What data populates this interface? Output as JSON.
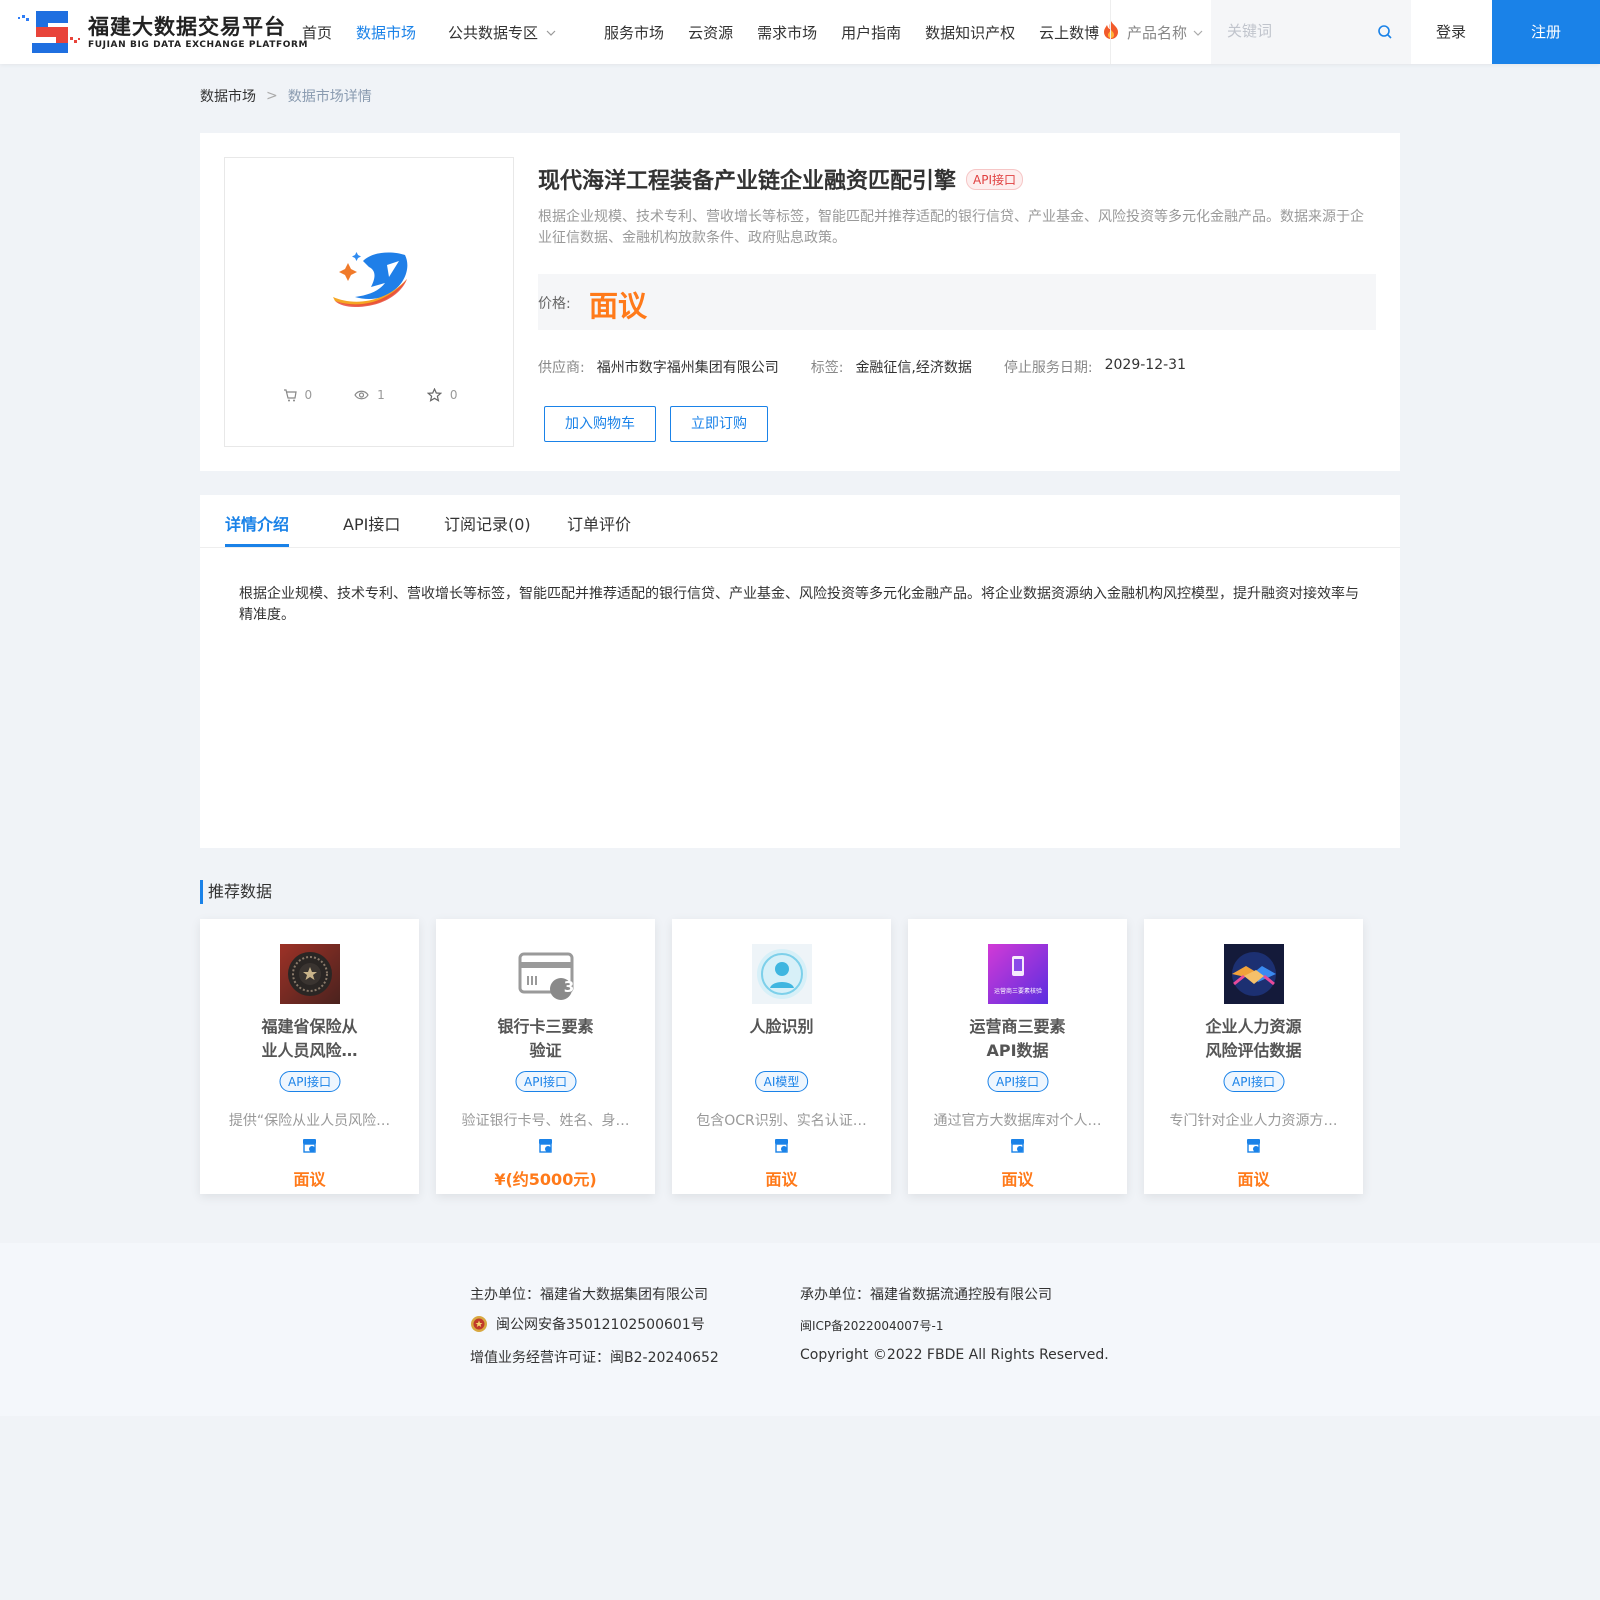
{
  "header": {
    "logo_cn": "福建大数据交易平台",
    "logo_en": "FUJIAN BIG DATA EXCHANGE  PLATFORM",
    "nav": [
      {
        "label": "首页"
      },
      {
        "label": "数据市场"
      },
      {
        "label": "公共数据专区"
      },
      {
        "label": "服务市场"
      },
      {
        "label": "云资源"
      },
      {
        "label": "需求市场"
      },
      {
        "label": "用户指南"
      },
      {
        "label": "数据知识产权"
      },
      {
        "label": "云上数博"
      }
    ],
    "active_nav": "数据市场",
    "search_type": "产品名称",
    "search_placeholder": "关键词",
    "login": "登录",
    "register": "注册",
    "accent_color": "#1a82e8"
  },
  "breadcrumb": {
    "home": "数据市场",
    "separator": ">",
    "current": "数据市场详情"
  },
  "product": {
    "title": "现代海洋工程装备产业链企业融资匹配引擎",
    "type_badge": "API接口",
    "description": "根据企业规模、技术专利、营收增长等标签，智能匹配并推荐适配的银行信贷、产业基金、风险投资等多元化金融产品。数据来源于企业征信数据、金融机构放款条件、政府贴息政策。",
    "price_label": "价格:",
    "price": "面议",
    "stats": {
      "cart": "0",
      "views": "1",
      "favorites": "0"
    },
    "supplier_label": "供应商:",
    "supplier": "福州市数字福州集团有限公司",
    "tags_label": "标签:",
    "tags": "金融征信,经济数据",
    "end_date_label": "停止服务日期:",
    "end_date": "2029-12-31",
    "add_cart": "加入购物车",
    "buy_now": "立即订购",
    "price_color": "#ff7a1a"
  },
  "tabs": [
    {
      "label": "详情介绍"
    },
    {
      "label": "API接口"
    },
    {
      "label": "订阅记录(0)"
    },
    {
      "label": "订单评价"
    }
  ],
  "active_tab": "详情介绍",
  "detail": {
    "text": "根据企业规模、技术专利、营收增长等标签，智能匹配并推荐适配的银行信贷、产业基金、风险投资等多元化金融产品。将企业数据资源纳入金融机构风控模型，提升融资对接效率与精准度。"
  },
  "recommend": {
    "title": "推荐数据",
    "items": [
      {
        "name_line1": "福建省保险从",
        "name_line2": "业人员风险…",
        "badge": "API接口",
        "desc": "提供“保险从业人员风险…",
        "price": "面议",
        "icon": "badge-emblem-icon"
      },
      {
        "name_line1": "银行卡三要素",
        "name_line2": "验证",
        "badge": "API接口",
        "desc": "验证银行卡号、姓名、身…",
        "price": "¥(约5000元)",
        "icon": "bank-card-icon"
      },
      {
        "name_line1": "人脸识别",
        "name_line2": "",
        "badge": "AI模型",
        "desc": "包含OCR识别、实名认证…",
        "price": "面议",
        "icon": "face-recognition-icon"
      },
      {
        "name_line1": "运营商三要素",
        "name_line2": "API数据",
        "badge": "API接口",
        "desc": "通过官方大数据库对个人…",
        "price": "面议",
        "icon": "phone-verify-icon",
        "icon_caption": "运营商三要素核验"
      },
      {
        "name_line1": "企业人力资源",
        "name_line2": "风险评估数据",
        "badge": "API接口",
        "desc": "专门针对企业人力资源方…",
        "price": "面议",
        "icon": "handshake-icon"
      }
    ]
  },
  "footer": {
    "sponsor": "主办单位：福建省大数据集团有限公司",
    "organizer": "承办单位：福建省数据流通控股有限公司",
    "police_record": "闽公网安备35012102500601号",
    "icp": "闽ICP备2022004007号-1",
    "license": "增值业务经营许可证：闽B2-20240652",
    "copyright": "Copyright ©2022 FBDE All Rights Reserved."
  }
}
